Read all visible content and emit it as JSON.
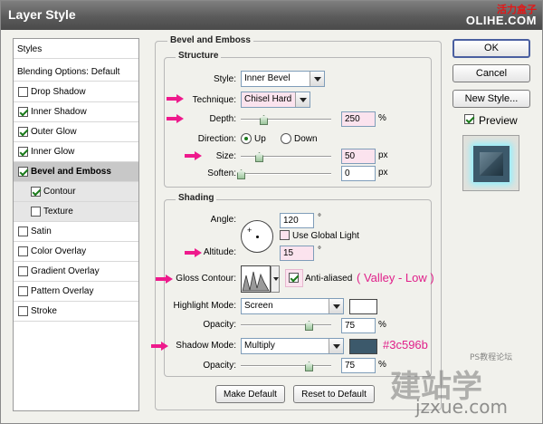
{
  "window": {
    "title": "Layer Style",
    "watermark_cn": "活力盒子",
    "watermark_site": "OLIHE.COM"
  },
  "styles_list": {
    "header": "Styles",
    "blending": "Blending Options: Default",
    "items": [
      {
        "label": "Drop Shadow",
        "checked": false
      },
      {
        "label": "Inner Shadow",
        "checked": true
      },
      {
        "label": "Outer Glow",
        "checked": true
      },
      {
        "label": "Inner Glow",
        "checked": true
      },
      {
        "label": "Bevel and Emboss",
        "checked": true
      },
      {
        "label": "Contour",
        "checked": true
      },
      {
        "label": "Texture",
        "checked": false
      },
      {
        "label": "Satin",
        "checked": false
      },
      {
        "label": "Color Overlay",
        "checked": false
      },
      {
        "label": "Gradient Overlay",
        "checked": false
      },
      {
        "label": "Pattern Overlay",
        "checked": false
      },
      {
        "label": "Stroke",
        "checked": false
      }
    ]
  },
  "panel": {
    "title": "Bevel and Emboss",
    "structure": {
      "title": "Structure",
      "style_label": "Style:",
      "style_value": "Inner Bevel",
      "technique_label": "Technique:",
      "technique_value": "Chisel Hard",
      "depth_label": "Depth:",
      "depth_value": "250",
      "depth_unit": "%",
      "depth_level": 0.25,
      "direction_label": "Direction:",
      "dir_up": "Up",
      "dir_down": "Down",
      "size_label": "Size:",
      "size_value": "50",
      "size_unit": "px",
      "size_level": 0.2,
      "soften_label": "Soften:",
      "soften_value": "0",
      "soften_unit": "px",
      "soften_level": 0
    },
    "shading": {
      "title": "Shading",
      "angle_label": "Angle:",
      "angle_value": "120",
      "angle_unit": "°",
      "global_light": "Use Global Light",
      "altitude_label": "Altitude:",
      "altitude_value": "15",
      "altitude_unit": "°",
      "gloss_label": "Gloss Contour:",
      "anti_aliased": "Anti-aliased",
      "gloss_note": "( Valley - Low )",
      "highlight_mode_label": "Highlight Mode:",
      "highlight_mode": "Screen",
      "highlight_color": "#ffffff",
      "highlight_opacity_label": "Opacity:",
      "highlight_opacity": "75",
      "highlight_opacity_unit": "%",
      "highlight_opacity_level": 0.75,
      "shadow_mode_label": "Shadow Mode:",
      "shadow_mode": "Multiply",
      "shadow_color": "#3c596b",
      "shadow_color_note": "#3c596b",
      "shadow_opacity_label": "Opacity:",
      "shadow_opacity": "75",
      "shadow_opacity_unit": "%",
      "shadow_opacity_level": 0.75
    },
    "make_default": "Make Default",
    "reset_default": "Reset to Default"
  },
  "right": {
    "ok": "OK",
    "cancel": "Cancel",
    "new_style": "New Style...",
    "preview": "Preview"
  },
  "footer_watermark": {
    "brand": "建站学",
    "site": "jzxue.com",
    "site_small": "PS教程论坛"
  },
  "colors": {
    "accent": "#ee1a8c",
    "note": "#e0208a"
  }
}
